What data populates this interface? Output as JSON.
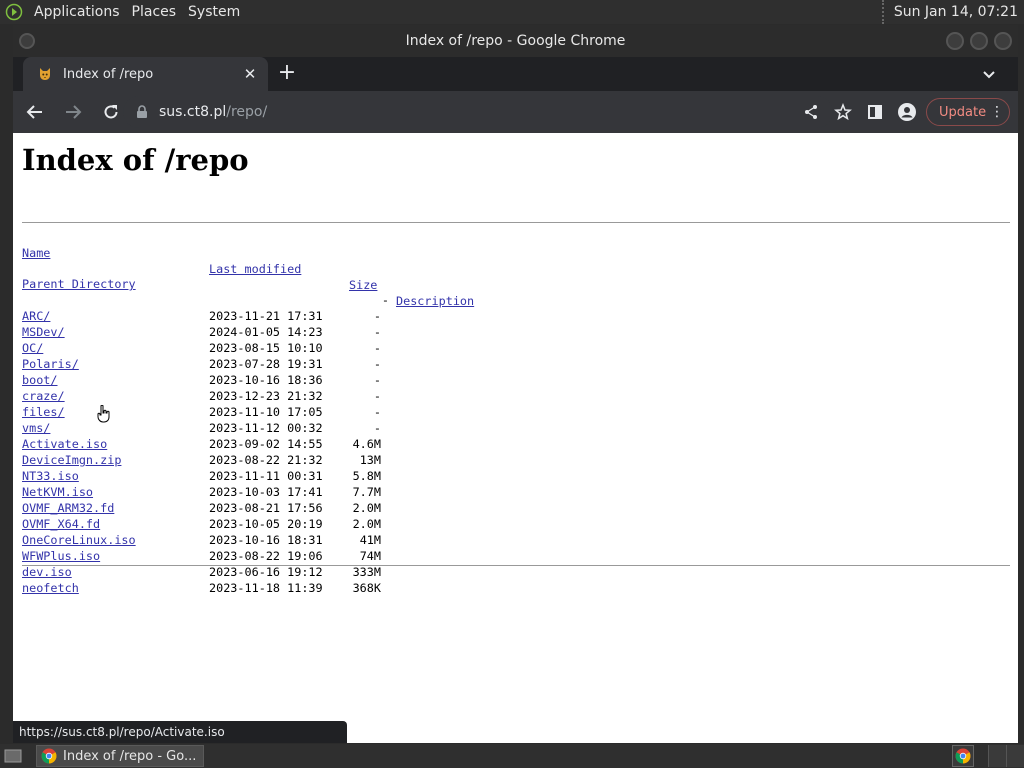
{
  "top_panel": {
    "menus": [
      "Applications",
      "Places",
      "System"
    ],
    "clock": "Sun Jan 14, 07:21"
  },
  "window": {
    "title": "Index of /repo - Google Chrome"
  },
  "tab": {
    "title": "Index of /repo",
    "close_label": "✕",
    "new_tab_label": "+"
  },
  "omnibox": {
    "host": "sus.ct8.pl",
    "path": "/repo/"
  },
  "toolbar": {
    "update_label": "Update"
  },
  "page": {
    "heading": "Index of /repo",
    "headers": {
      "name": "Name",
      "modified": "Last modified",
      "size": "Size",
      "description": "Description"
    },
    "parent": {
      "name": "Parent Directory",
      "size": "-"
    },
    "rows": [
      {
        "name": "ARC/",
        "modified": "2023-11-21 17:31",
        "size": "-"
      },
      {
        "name": "MSDev/",
        "modified": "2024-01-05 14:23",
        "size": "-"
      },
      {
        "name": "OC/",
        "modified": "2023-08-15 10:10",
        "size": "-"
      },
      {
        "name": "Polaris/",
        "modified": "2023-07-28 19:31",
        "size": "-"
      },
      {
        "name": "boot/",
        "modified": "2023-10-16 18:36",
        "size": "-"
      },
      {
        "name": "craze/",
        "modified": "2023-12-23 21:32",
        "size": "-"
      },
      {
        "name": "files/",
        "modified": "2023-11-10 17:05",
        "size": "-"
      },
      {
        "name": "vms/",
        "modified": "2023-11-12 00:32",
        "size": "-"
      },
      {
        "name": "Activate.iso",
        "modified": "2023-09-02 14:55",
        "size": "4.6M"
      },
      {
        "name": "DeviceImgn.zip",
        "modified": "2023-08-22 21:32",
        "size": "13M"
      },
      {
        "name": "NT33.iso",
        "modified": "2023-11-11 00:31",
        "size": "5.8M"
      },
      {
        "name": "NetKVM.iso",
        "modified": "2023-10-03 17:41",
        "size": "7.7M"
      },
      {
        "name": "OVMF_ARM32.fd",
        "modified": "2023-08-21 17:56",
        "size": "2.0M"
      },
      {
        "name": "OVMF_X64.fd",
        "modified": "2023-10-05 20:19",
        "size": "2.0M"
      },
      {
        "name": "OneCoreLinux.iso",
        "modified": "2023-10-16 18:31",
        "size": "41M"
      },
      {
        "name": "WFWPlus.iso",
        "modified": "2023-08-22 19:06",
        "size": "74M"
      },
      {
        "name": "dev.iso",
        "modified": "2023-06-16 19:12",
        "size": "333M"
      },
      {
        "name": "neofetch",
        "modified": "2023-11-18 11:39",
        "size": "368K"
      }
    ]
  },
  "status_url": "https://sus.ct8.pl/repo/Activate.iso",
  "taskbar": {
    "task_label": "Index of /repo - Go..."
  },
  "colors": {
    "link": "#3333aa",
    "update_text": "#f28b82"
  }
}
